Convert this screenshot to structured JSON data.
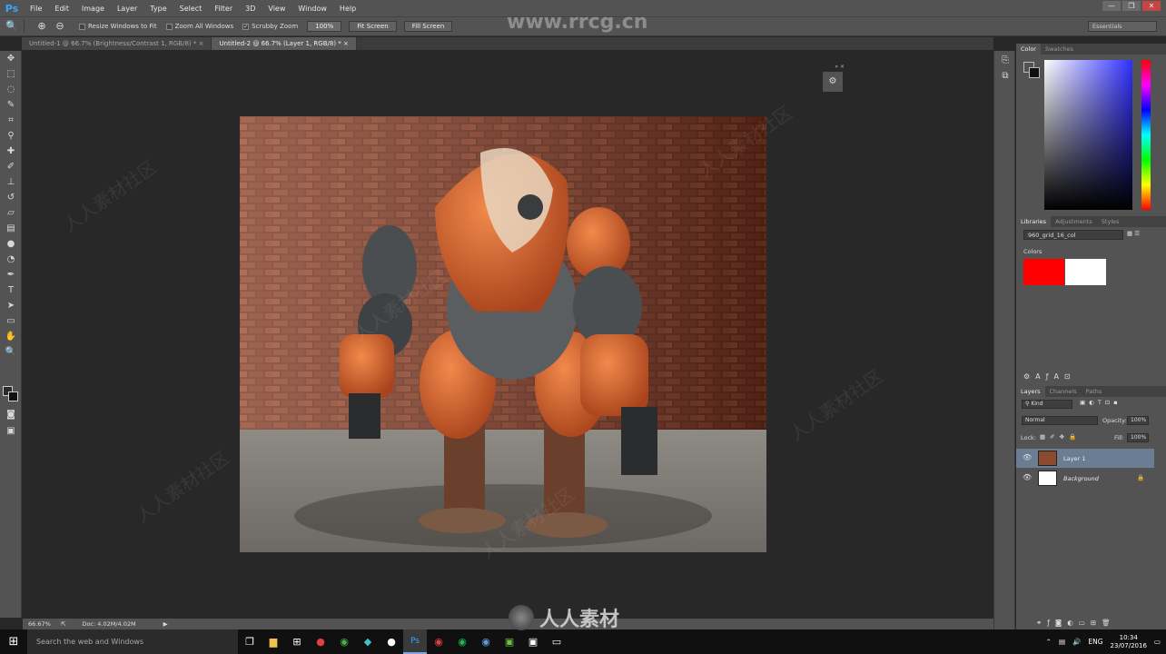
{
  "app": {
    "logo": "Ps"
  },
  "menu": [
    "File",
    "Edit",
    "Image",
    "Layer",
    "Type",
    "Select",
    "Filter",
    "3D",
    "View",
    "Window",
    "Help"
  ],
  "window_controls": {
    "minimize": "—",
    "restore": "❐",
    "close": "✕"
  },
  "options_bar": {
    "resize_windows_label": "Resize Windows to Fit",
    "zoom_all_label": "Zoom All Windows",
    "scrubby_zoom_label": "Scrubby Zoom",
    "zoom_value": "100%",
    "fit_screen_label": "Fit Screen",
    "fill_screen_label": "Fill Screen",
    "workspace": "Essentials"
  },
  "watermark_url": "www.rrcg.cn",
  "doc_tabs": [
    {
      "label": "Untitled-1 @ 66.7% (Brightness/Contrast 1, RGB/8) *",
      "active": false
    },
    {
      "label": "Untitled-2 @ 66.7% (Layer 1, RGB/8) *",
      "active": true
    }
  ],
  "status": {
    "zoom": "66.67%",
    "doc": "Doc: 4.02M/4.02M"
  },
  "panels": {
    "color_tabs": [
      "Color",
      "Swatches"
    ],
    "library_tabs": [
      "Libraries",
      "Adjustments",
      "Styles"
    ],
    "library_name": "960_grid_16_col",
    "colors_label": "Colors",
    "color_chips": [
      "#ff0000",
      "#ffffff"
    ],
    "layers_tabs": [
      "Layers",
      "Channels",
      "Paths"
    ],
    "kind_label": "Kind",
    "blend_mode": "Normal",
    "opacity_label": "Opacity:",
    "opacity_value": "100%",
    "lock_label": "Lock:",
    "fill_label": "Fill:",
    "fill_value": "100%",
    "layers": [
      {
        "name": "Layer 1",
        "selected": true
      },
      {
        "name": "Background",
        "selected": false
      }
    ]
  },
  "taskbar": {
    "search_placeholder": "Search the web and Windows",
    "language": "ENG",
    "time": "10:34",
    "date": "23/07/2016"
  },
  "watermark_text": "人人素材社区",
  "bottom_logo_text": "人人素材"
}
